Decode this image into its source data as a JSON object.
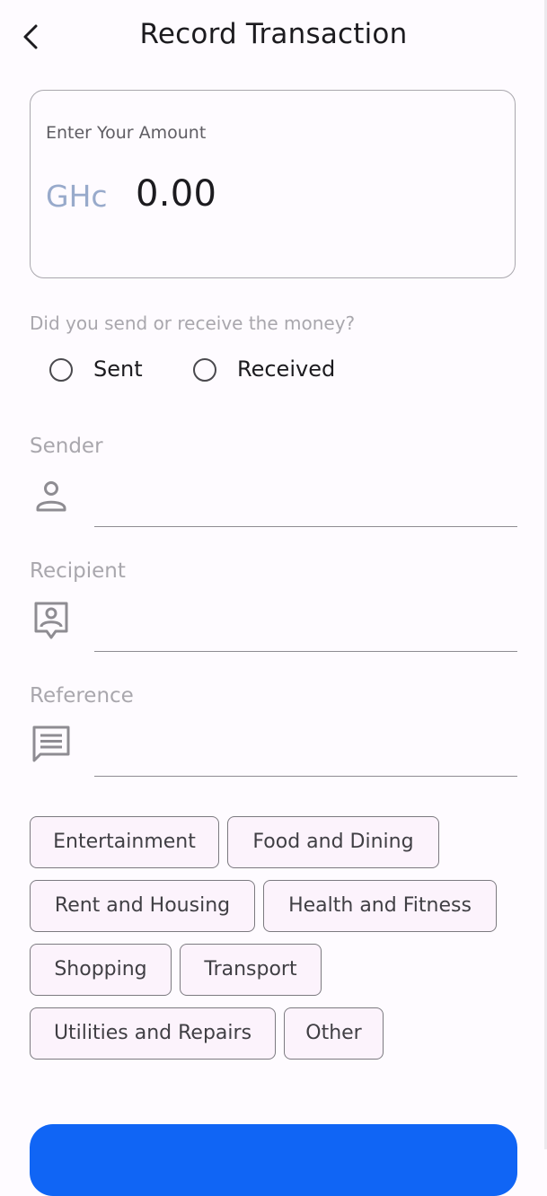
{
  "header": {
    "title": "Record Transaction",
    "back_icon": "chevron-left-icon"
  },
  "amount": {
    "label": "Enter Your Amount",
    "currency": "GHc",
    "value": "0.00"
  },
  "direction": {
    "question": "Did you send or receive the money?",
    "options": [
      {
        "label": "Sent",
        "selected": false
      },
      {
        "label": "Received",
        "selected": false
      }
    ]
  },
  "fields": {
    "sender": {
      "label": "Sender",
      "icon": "person-icon",
      "value": ""
    },
    "recipient": {
      "label": "Recipient",
      "icon": "contact-card-icon",
      "value": ""
    },
    "reference": {
      "label": "Reference",
      "icon": "message-icon",
      "value": ""
    }
  },
  "categories": [
    "Entertainment",
    "Food and Dining",
    "Rent and Housing",
    "Health and Fitness",
    "Shopping",
    "Transport",
    "Utilities and Repairs",
    "Other"
  ],
  "colors": {
    "accent": "#1065f5",
    "currency": "#98aacb",
    "chip_background": "#fcf3fc",
    "muted_text": "#a9a7ad"
  }
}
